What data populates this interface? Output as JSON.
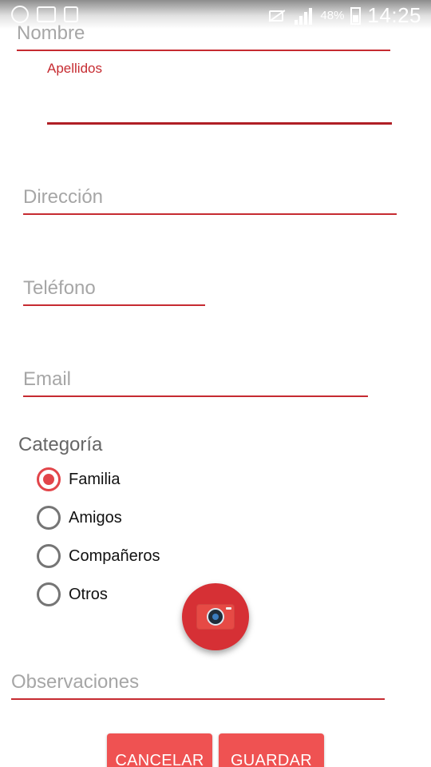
{
  "status_bar": {
    "battery_percent": "48%",
    "time": "14:25",
    "left_icons": [
      "location-icon",
      "image-icon",
      "sim-icon"
    ],
    "right_icons": [
      "mute-icon",
      "signal-icon",
      "battery-icon"
    ]
  },
  "form": {
    "nombre": {
      "placeholder": "Nombre"
    },
    "apellidos": {
      "label": "Apellidos",
      "value": ""
    },
    "direccion": {
      "placeholder": "Dirección"
    },
    "telefono": {
      "placeholder": "Teléfono"
    },
    "email": {
      "placeholder": "Email"
    },
    "observaciones": {
      "placeholder": "Observaciones"
    }
  },
  "category": {
    "title": "Categoría",
    "options": [
      {
        "label": "Familia",
        "checked": true
      },
      {
        "label": "Amigos",
        "checked": false
      },
      {
        "label": "Compañeros",
        "checked": false
      },
      {
        "label": "Otros",
        "checked": false
      }
    ]
  },
  "fab": {
    "icon": "camera-icon"
  },
  "buttons": {
    "cancel": "CANCELAR",
    "save": "GUARDAR"
  },
  "colors": {
    "accent": "#c62b31",
    "radio_checked": "#e2454a",
    "button": "#ef5252",
    "fab": "#d63035"
  }
}
